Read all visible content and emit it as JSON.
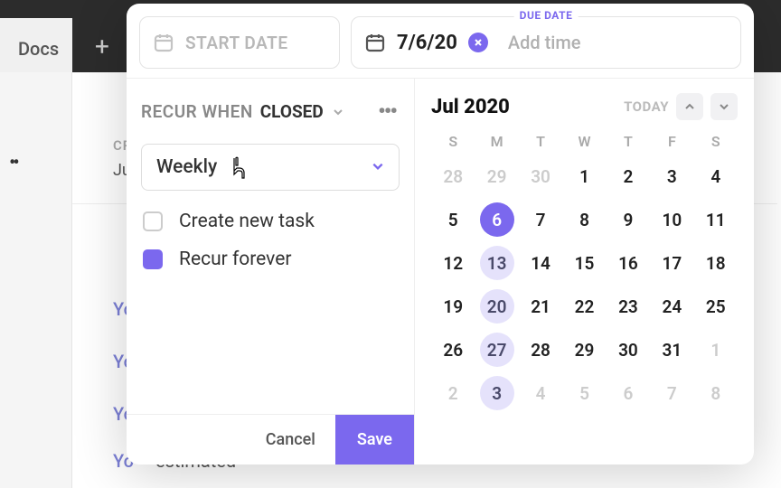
{
  "background": {
    "doc_label": "Docs",
    "cr": "CR",
    "ju": "Ju",
    "you": "Yo",
    "estimated": "estimated"
  },
  "header": {
    "start": {
      "placeholder": "START DATE"
    },
    "due": {
      "label": "DUE DATE",
      "value": "7/6/20",
      "add_time": "Add time"
    }
  },
  "recur": {
    "prefix": "RECUR WHEN",
    "state": "CLOSED",
    "frequency": "Weekly",
    "options": {
      "create_new_task": {
        "label": "Create new task",
        "checked": false
      },
      "recur_forever": {
        "label": "Recur forever",
        "checked": true
      }
    }
  },
  "footer": {
    "cancel": "Cancel",
    "save": "Save"
  },
  "calendar": {
    "month_title": "Jul 2020",
    "today_label": "TODAY",
    "dow": [
      "S",
      "M",
      "T",
      "W",
      "T",
      "F",
      "S"
    ],
    "weeks": [
      [
        {
          "n": 28,
          "out": true
        },
        {
          "n": 29,
          "out": true
        },
        {
          "n": 30,
          "out": true
        },
        {
          "n": 1
        },
        {
          "n": 2
        },
        {
          "n": 3
        },
        {
          "n": 4
        }
      ],
      [
        {
          "n": 5
        },
        {
          "n": 6,
          "selected": true
        },
        {
          "n": 7
        },
        {
          "n": 8
        },
        {
          "n": 9
        },
        {
          "n": 10
        },
        {
          "n": 11
        }
      ],
      [
        {
          "n": 12
        },
        {
          "n": 13,
          "hilite": true
        },
        {
          "n": 14
        },
        {
          "n": 15
        },
        {
          "n": 16
        },
        {
          "n": 17
        },
        {
          "n": 18
        }
      ],
      [
        {
          "n": 19
        },
        {
          "n": 20,
          "hilite": true
        },
        {
          "n": 21
        },
        {
          "n": 22
        },
        {
          "n": 23
        },
        {
          "n": 24
        },
        {
          "n": 25
        }
      ],
      [
        {
          "n": 26
        },
        {
          "n": 27,
          "hilite": true
        },
        {
          "n": 28
        },
        {
          "n": 29
        },
        {
          "n": 30
        },
        {
          "n": 31
        },
        {
          "n": 1,
          "out": true
        }
      ],
      [
        {
          "n": 2,
          "out": true
        },
        {
          "n": 3,
          "out": true,
          "hilite": true
        },
        {
          "n": 4,
          "out": true
        },
        {
          "n": 5,
          "out": true
        },
        {
          "n": 6,
          "out": true
        },
        {
          "n": 7,
          "out": true
        },
        {
          "n": 8,
          "out": true
        }
      ]
    ]
  },
  "colors": {
    "accent": "#7b68ee"
  }
}
